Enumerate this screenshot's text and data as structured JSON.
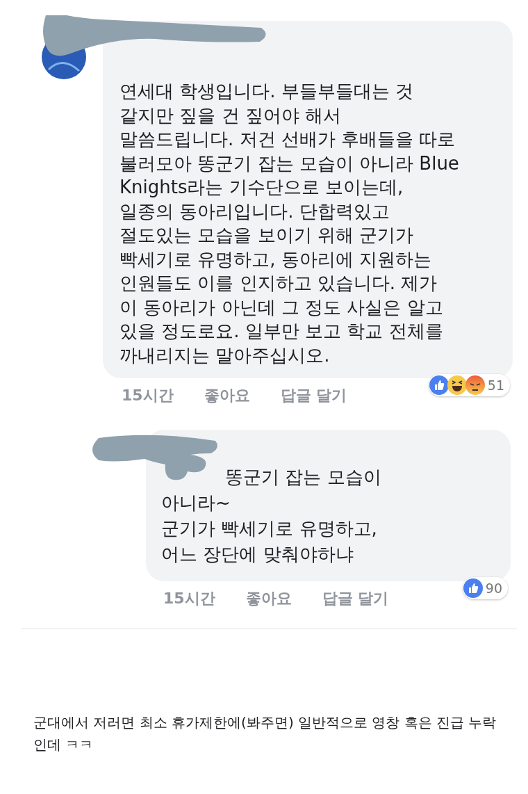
{
  "comments": [
    {
      "redacted": true,
      "lead_hidden": false,
      "lines": [
        "연세대 학생입니다. 부들부들대는 것",
        "같지만 짚을 건 짚어야 해서",
        "말씀드립니다. 저건 선배가 후배들을 따로",
        "불러모아 똥군기 잡는 모습이 아니라 Blue",
        "Knights라는 기수단으로 보이는데,",
        "일종의 동아리입니다. 단합력있고",
        "절도있는 모습을 보이기 위해 군기가",
        "빡세기로 유명하고, 동아리에 지원하는",
        "인원들도 이를 인지하고 있습니다. 제가",
        "이 동아리가 아닌데 그 정도 사실은 알고",
        "있을 정도로요. 일부만 보고 학교 전체를",
        "까내리지는 말아주십시오."
      ],
      "time": "15시간",
      "like": "좋아요",
      "reply": "답글 달기",
      "reactions": [
        {
          "kind": "like"
        },
        {
          "kind": "haha"
        },
        {
          "kind": "angry"
        }
      ],
      "reaction_count": "51"
    },
    {
      "redacted": true,
      "lead_hidden": true,
      "lines": [
        "똥군기 잡는 모습이",
        "아니라~",
        "군기가 빡세기로 유명하고,",
        "어느 장단에 맞춰야하냐"
      ],
      "time": "15시간",
      "like": "좋아요",
      "reply": "답글 달기",
      "reactions": [
        {
          "kind": "like"
        }
      ],
      "reaction_count": "90"
    }
  ],
  "post_text": "군대에서 저러면 최소 휴가제한에(봐주면) 일반적으로 영창 혹은 진급 누락인데 ㅋㅋ"
}
